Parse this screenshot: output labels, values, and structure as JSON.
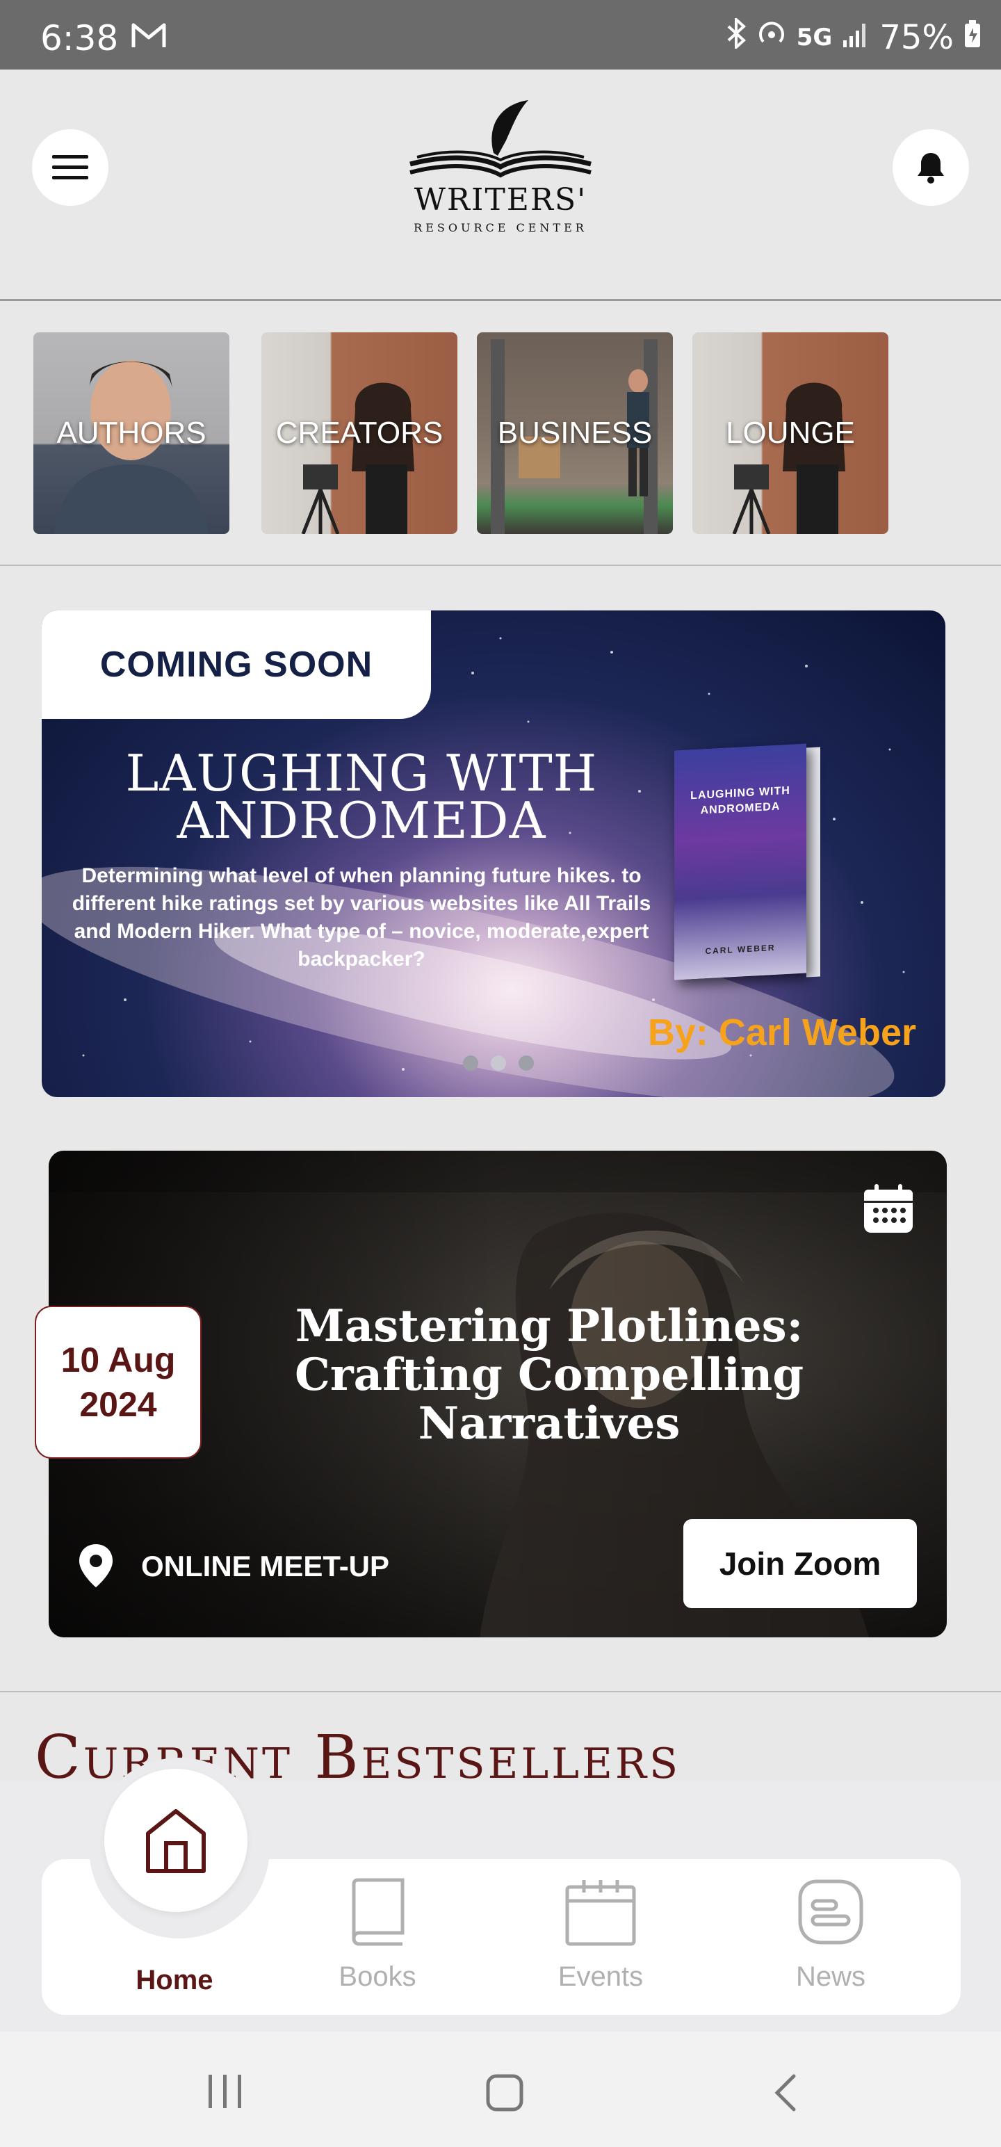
{
  "status_bar": {
    "time": "6:38",
    "network": "5G",
    "battery": "75%"
  },
  "header": {
    "logo_title": "WRITERS'",
    "logo_subtitle": "RESOURCE CENTER",
    "menu_icon": "hamburger-menu-icon",
    "bell_icon": "bell-icon"
  },
  "categories": [
    {
      "label": "AUTHORS"
    },
    {
      "label": "CREATORS"
    },
    {
      "label": "BUSINESS"
    },
    {
      "label": "LOUNGE"
    }
  ],
  "hero": {
    "tag": "COMING SOON",
    "title_line1": "LAUGHING WITH",
    "title_line2": "ANDROMEDA",
    "description": "Determining what level of when planning future hikes.   to different hike ratings set by various websites like All Trails and Modern Hiker. What type of  – novice, moderate,expert backpacker?",
    "book_title": "LAUGHING WITH ANDROMEDA",
    "book_author": "CARL WEBER",
    "author_line": "By: Carl Weber",
    "active_slide": 1,
    "slide_count": 3
  },
  "event": {
    "date_day": "10 Aug",
    "date_year": "2024",
    "title": "Mastering Plotlines: Crafting Compelling Narratives",
    "location": "ONLINE MEET-UP",
    "join_label": "Join Zoom"
  },
  "bestsellers": {
    "title": "Current Bestsellers"
  },
  "bottom_nav": {
    "items": [
      {
        "label": "Home",
        "icon": "home-icon",
        "active": true
      },
      {
        "label": "Books",
        "icon": "book-icon",
        "active": false
      },
      {
        "label": "Events",
        "icon": "calendar-icon",
        "active": false
      },
      {
        "label": "News",
        "icon": "news-icon",
        "active": false
      }
    ]
  },
  "colors": {
    "accent": "#5a1515",
    "hero_tag_text": "#142046",
    "author_orange": "#f7a21b",
    "inactive_nav": "#b0b0b0"
  }
}
